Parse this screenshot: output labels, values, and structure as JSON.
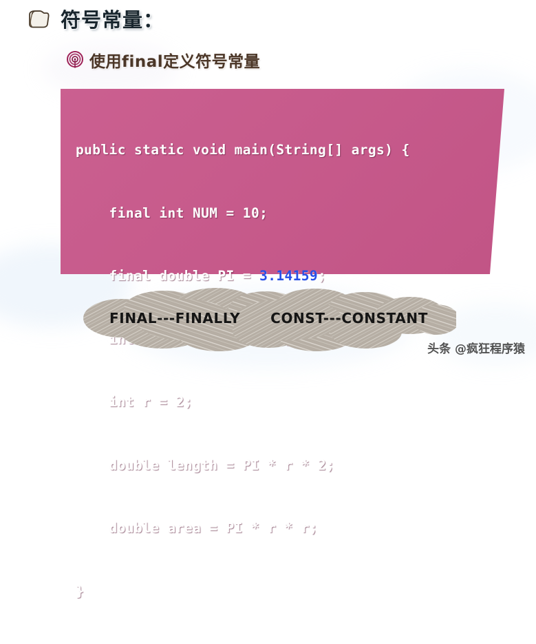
{
  "slide": {
    "title": "符号常量：",
    "title_icon": "folder-icon",
    "subtitle": "使用final定义符号常量",
    "subtitle_icon": "target-bullet-icon",
    "title_color": "#19262e",
    "subtitle_color": "#4b3627"
  },
  "code_block": {
    "background_color": "#c8578a",
    "text_color": "#ffffff",
    "number_literal_color": "#2750e8",
    "language": "java",
    "lines": [
      "public static void main(String[] args) {",
      "    final int NUM = 10;",
      "    final double PI = ",
      "    int x[] = new int[NUM];",
      "    int r = 2;",
      "    double length = PI * r * 2;",
      "    double area = PI * r * r;",
      "}"
    ],
    "line_3_prefix": "    final double PI = ",
    "line_3_number": "3.14159",
    "line_3_suffix": ";"
  },
  "cloud_note": {
    "fill_color": "#b6aea4",
    "items": [
      "FINAL---FINALLY",
      "CONST---CONSTANT"
    ]
  },
  "watermark": {
    "text": "头条 @疯狂程序猿"
  }
}
